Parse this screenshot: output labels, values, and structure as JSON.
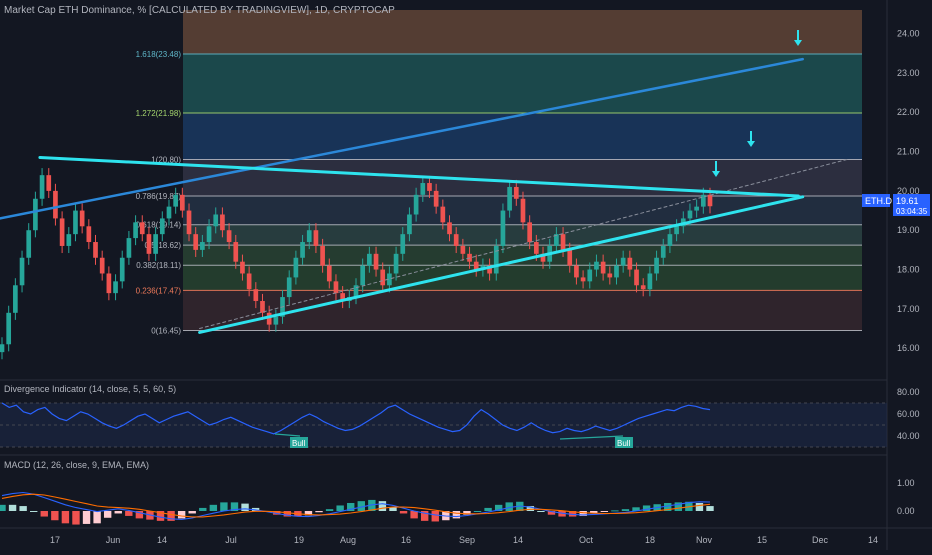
{
  "title": "Market Cap ETH Dominance, % [CALCULATED BY TRADINGVIEW], 1D, CRYPTOCAP",
  "colors": {
    "bg": "#131722",
    "bull": "#26a69a",
    "bear": "#ef5350",
    "trendline": "#2ee3ee",
    "channel": "#2b88d9",
    "axis_text": "#b2b5be",
    "arrow": "#2ee3ee",
    "rsi": "#2962ff",
    "macd": "#2962ff",
    "signal": "#ff6d00"
  },
  "price_panel": {
    "y_ticks": [
      "24.00",
      "23.00",
      "22.00",
      "21.00",
      "20.00",
      "19.00",
      "18.00",
      "17.00",
      "16.00"
    ],
    "symbol_label": "ETH.D",
    "last_price": "19.61",
    "countdown": "03:04:35"
  },
  "x_ticks": [
    "17",
    "Jun",
    "14",
    "Jul",
    "19",
    "Aug",
    "16",
    "Sep",
    "14",
    "Oct",
    "18",
    "Nov",
    "15",
    "Dec",
    "14"
  ],
  "chart_data": {
    "type": "candlestick",
    "ylim": [
      15.7,
      24.6
    ],
    "fib_levels": [
      {
        "label": "1.618(23.48)",
        "value": 23.48,
        "color": "#5fb6c8"
      },
      {
        "label": "1.272(21.98)",
        "value": 21.98,
        "color": "#a5d66e"
      },
      {
        "label": "1(20.80)",
        "value": 20.8,
        "color": "#b2b5be"
      },
      {
        "label": "0.786(19.87)",
        "value": 19.87,
        "color": "#b2b5be"
      },
      {
        "label": "0.618(19.14)",
        "value": 19.14,
        "color": "#b2b5be"
      },
      {
        "label": "0.5(18.62)",
        "value": 18.62,
        "color": "#b2b5be"
      },
      {
        "label": "0.382(18.11)",
        "value": 18.11,
        "color": "#b2b5be"
      },
      {
        "label": "0.236(17.47)",
        "value": 17.47,
        "color": "#ef7a5a"
      },
      {
        "label": "0(16.45)",
        "value": 16.45,
        "color": "#b2b5be"
      }
    ],
    "close_series": [
      16.1,
      16.9,
      17.6,
      18.3,
      19.0,
      19.8,
      20.4,
      20.0,
      19.3,
      18.6,
      18.9,
      19.5,
      19.1,
      18.7,
      18.3,
      17.9,
      17.4,
      17.7,
      18.3,
      18.8,
      19.2,
      18.9,
      18.4,
      18.9,
      19.3,
      19.6,
      19.9,
      19.5,
      18.9,
      18.5,
      18.7,
      19.1,
      19.4,
      19.0,
      18.7,
      18.2,
      17.9,
      17.5,
      17.2,
      16.9,
      16.6,
      16.8,
      17.3,
      17.8,
      18.3,
      18.7,
      19.0,
      18.6,
      18.1,
      17.7,
      17.4,
      17.2,
      17.3,
      17.6,
      18.1,
      18.4,
      18.0,
      17.6,
      17.9,
      18.4,
      18.9,
      19.4,
      19.9,
      20.2,
      20.0,
      19.6,
      19.2,
      18.9,
      18.6,
      18.4,
      18.2,
      18.0,
      18.1,
      17.9,
      18.6,
      19.5,
      20.1,
      19.8,
      19.2,
      18.7,
      18.4,
      18.2,
      18.6,
      18.9,
      18.5,
      18.1,
      17.8,
      17.7,
      18.0,
      18.2,
      17.9,
      17.8,
      18.1,
      18.3,
      18.0,
      17.6,
      17.5,
      17.9,
      18.3,
      18.6,
      18.9,
      19.1,
      19.3,
      19.5,
      19.6,
      19.9,
      19.61
    ],
    "triangle_upper": {
      "points": [
        [
          0.045,
          20.85
        ],
        [
          0.9,
          19.87
        ]
      ]
    },
    "triangle_lower": {
      "points": [
        [
          0.225,
          16.4
        ],
        [
          0.905,
          19.85
        ]
      ]
    },
    "channel_line": {
      "points": [
        [
          0.0,
          19.3
        ],
        [
          0.905,
          23.35
        ]
      ]
    },
    "dotted_line": {
      "points": [
        [
          0.225,
          16.5
        ],
        [
          0.955,
          20.8
        ]
      ]
    }
  },
  "rsi_panel": {
    "label": "Divergence Indicator (14, close, 5, 5, 60, 5)",
    "y_ticks": [
      "80.00",
      "60.00",
      "40.00"
    ],
    "bull_labels": [
      "Bull",
      "Bull"
    ],
    "values": [
      70,
      66,
      68,
      62,
      60,
      64,
      66,
      60,
      56,
      54,
      58,
      62,
      60,
      56,
      52,
      49,
      47,
      50,
      54,
      58,
      60,
      56,
      52,
      55,
      58,
      60,
      62,
      58,
      54,
      50,
      52,
      55,
      57,
      54,
      51,
      48,
      46,
      44,
      42,
      45,
      49,
      53,
      57,
      60,
      57,
      53,
      50,
      47,
      45,
      46,
      49,
      53,
      57,
      61,
      66,
      68,
      64,
      60,
      57,
      54,
      51,
      48,
      46,
      44,
      45,
      50,
      58,
      64,
      60,
      55,
      50,
      47,
      45,
      48,
      52,
      48,
      45,
      43,
      44,
      47,
      45,
      44,
      46,
      49,
      47,
      45,
      47,
      50,
      53,
      56,
      58,
      60,
      62,
      64,
      63,
      66,
      68,
      67,
      65,
      64
    ]
  },
  "macd_panel": {
    "label": "MACD (12, 26, close, 9, EMA, EMA)",
    "y_ticks": [
      "1.00",
      "0.00"
    ],
    "macd": [
      0.55,
      0.62,
      0.66,
      0.6,
      0.48,
      0.35,
      0.22,
      0.12,
      0.05,
      -0.02,
      0.03,
      0.08,
      0.02,
      -0.06,
      -0.14,
      -0.22,
      -0.28,
      -0.3,
      -0.25,
      -0.16,
      -0.08,
      0.0,
      0.05,
      0.08,
      0.04,
      -0.02,
      -0.09,
      -0.15,
      -0.19,
      -0.2,
      -0.16,
      -0.1,
      -0.02,
      0.06,
      0.14,
      0.22,
      0.26,
      0.2,
      0.1,
      0.0,
      -0.08,
      -0.14,
      -0.18,
      -0.2,
      -0.16,
      -0.1,
      -0.04,
      0.04,
      0.12,
      0.18,
      0.14,
      0.06,
      -0.02,
      -0.08,
      -0.12,
      -0.14,
      -0.12,
      -0.1,
      -0.08,
      -0.05,
      0.0,
      0.06,
      0.12,
      0.18,
      0.24,
      0.3,
      0.33,
      0.32
    ],
    "signal": [
      0.45,
      0.52,
      0.58,
      0.6,
      0.57,
      0.5,
      0.42,
      0.34,
      0.26,
      0.18,
      0.14,
      0.12,
      0.1,
      0.06,
      0.0,
      -0.06,
      -0.12,
      -0.18,
      -0.21,
      -0.21,
      -0.18,
      -0.14,
      -0.09,
      -0.04,
      -0.01,
      -0.01,
      -0.03,
      -0.06,
      -0.1,
      -0.13,
      -0.14,
      -0.13,
      -0.11,
      -0.07,
      -0.02,
      0.04,
      0.1,
      0.14,
      0.14,
      0.12,
      0.08,
      0.03,
      -0.03,
      -0.08,
      -0.1,
      -0.1,
      -0.09,
      -0.06,
      -0.02,
      0.03,
      0.06,
      0.06,
      0.04,
      0.01,
      -0.03,
      -0.06,
      -0.08,
      -0.09,
      -0.09,
      -0.08,
      -0.06,
      -0.03,
      0.01,
      0.05,
      0.1,
      0.15,
      0.2,
      0.24
    ]
  }
}
